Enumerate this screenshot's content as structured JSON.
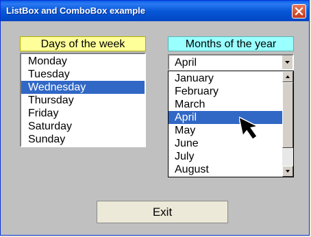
{
  "window": {
    "title": "ListBox and ComboBox example"
  },
  "days": {
    "caption": "Days of the week",
    "items": [
      "Monday",
      "Tuesday",
      "Wednesday",
      "Thursday",
      "Friday",
      "Saturday",
      "Sunday"
    ],
    "selected": "Wednesday"
  },
  "months": {
    "caption": "Months of the year",
    "combo_value": "April",
    "items": [
      "January",
      "February",
      "March",
      "April",
      "May",
      "June",
      "July",
      "August"
    ],
    "selected": "April"
  },
  "exit_label": "Exit",
  "colors": {
    "selection": "#3168c6",
    "days_caption_bg": "#ffff99",
    "months_caption_bg": "#99ffff"
  }
}
